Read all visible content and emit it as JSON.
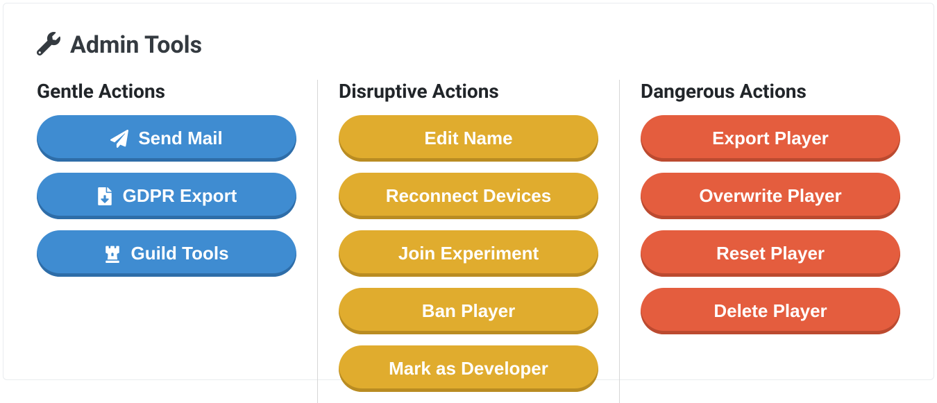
{
  "title": "Admin Tools",
  "columns": {
    "gentle": {
      "title": "Gentle Actions",
      "buttons": {
        "send_mail": "Send Mail",
        "gdpr_export": "GDPR Export",
        "guild_tools": "Guild Tools"
      }
    },
    "disruptive": {
      "title": "Disruptive Actions",
      "buttons": {
        "edit_name": "Edit Name",
        "reconnect_devices": "Reconnect Devices",
        "join_experiment": "Join Experiment",
        "ban_player": "Ban Player",
        "mark_developer": "Mark as Developer"
      }
    },
    "dangerous": {
      "title": "Dangerous Actions",
      "buttons": {
        "export_player": "Export Player",
        "overwrite_player": "Overwrite Player",
        "reset_player": "Reset Player",
        "delete_player": "Delete Player"
      }
    }
  }
}
